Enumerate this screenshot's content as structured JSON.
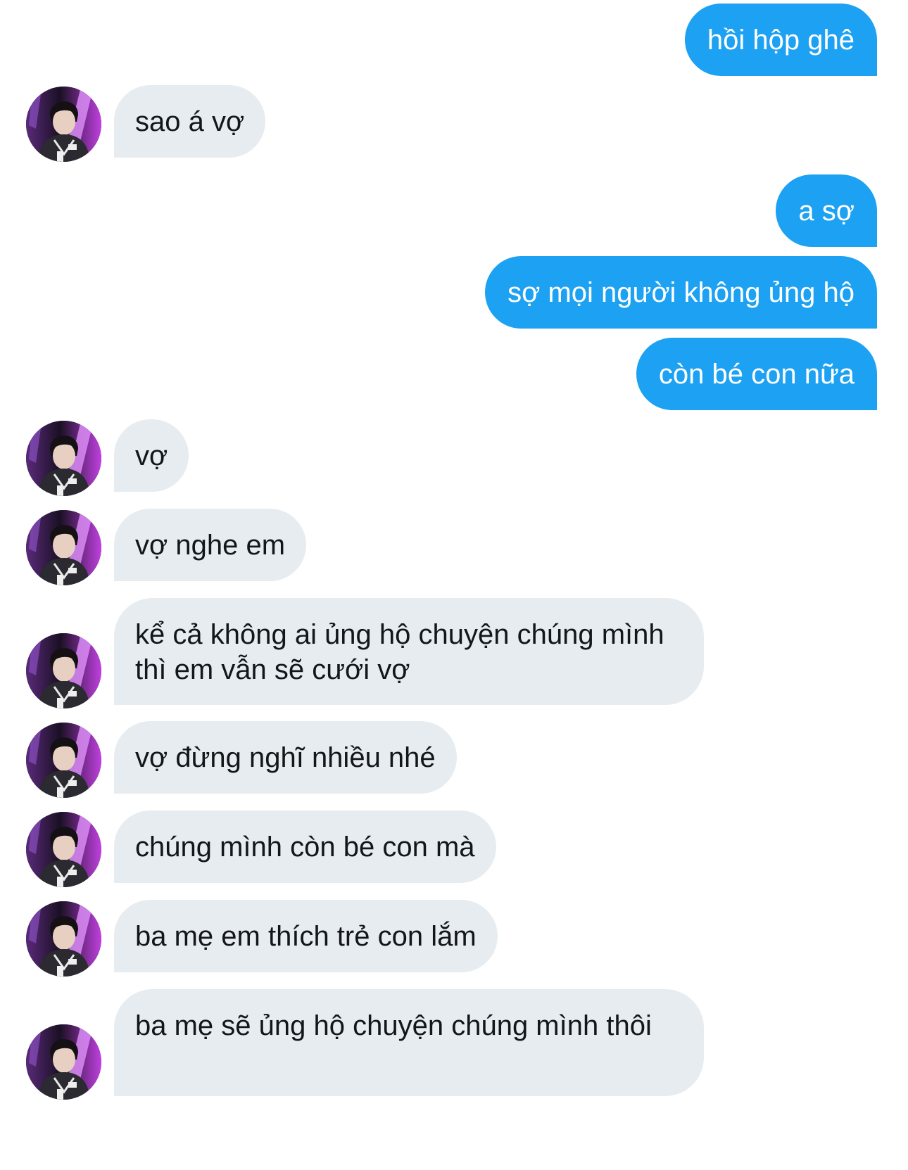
{
  "colors": {
    "sent_bubble": "#1da1f2",
    "sent_text": "#ffffff",
    "received_bubble": "#e6ecf0",
    "received_text": "#14171a",
    "background": "#ffffff"
  },
  "conversation": {
    "messages": [
      {
        "sender": "me",
        "text": "hồi hộp ghê"
      },
      {
        "sender": "other",
        "text": "sao á vợ",
        "avatar": "avatar-photo"
      },
      {
        "sender": "me",
        "text": "a sợ"
      },
      {
        "sender": "me",
        "text": "sợ mọi người không ủng hộ"
      },
      {
        "sender": "me",
        "text": "còn bé con nữa"
      },
      {
        "sender": "other",
        "text": "vợ",
        "avatar": "avatar-photo"
      },
      {
        "sender": "other",
        "text": "vợ nghe em",
        "avatar": "avatar-photo"
      },
      {
        "sender": "other",
        "text": "kể cả không ai ủng hộ chuyện chúng mình thì em vẫn sẽ cưới vợ",
        "avatar": "avatar-photo"
      },
      {
        "sender": "other",
        "text": "vợ đừng nghĩ nhiều nhé",
        "avatar": "avatar-photo"
      },
      {
        "sender": "other",
        "text": "chúng mình còn bé con mà",
        "avatar": "avatar-photo"
      },
      {
        "sender": "other",
        "text": "ba mẹ em thích trẻ con lắm",
        "avatar": "avatar-photo"
      },
      {
        "sender": "other",
        "text": "ba mẹ sẽ ủng hộ chuyện chúng mình thôi",
        "avatar": "avatar-photo"
      }
    ]
  }
}
